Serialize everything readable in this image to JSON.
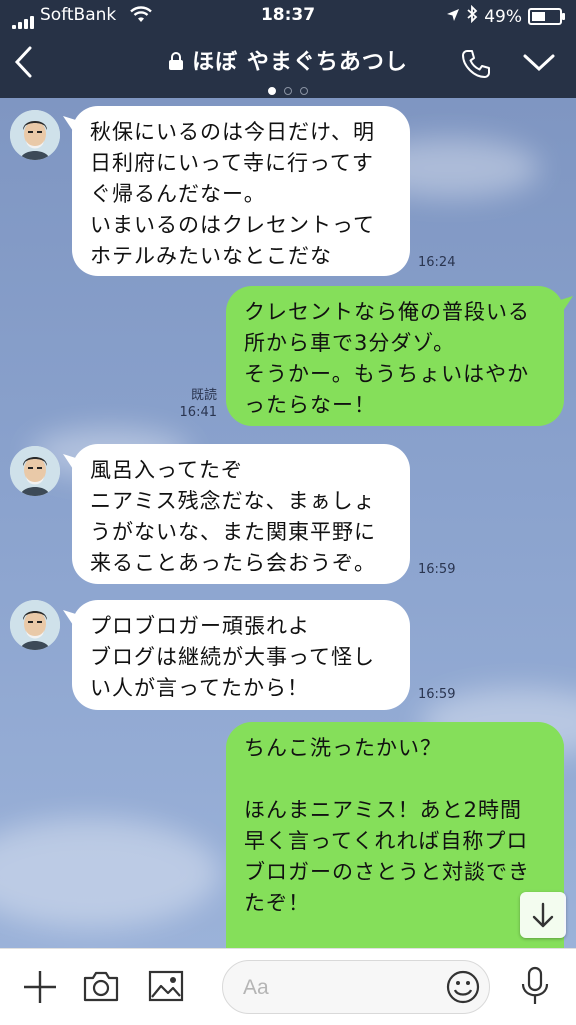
{
  "status": {
    "carrier": "SoftBank",
    "time": "18:37",
    "battery": "49%"
  },
  "header": {
    "title": "ほぼ やまぐちあつし",
    "page_dots": 3,
    "active_dot": 0
  },
  "messages": [
    {
      "side": "in",
      "text": "秋保にいるのは今日だけ、明\n日利府にいって寺に行ってす\nぐ帰るんだなー。\nいまいるのはクレセントって\nホテルみたいなとこだな",
      "time": "16:24"
    },
    {
      "side": "out",
      "text": "クレセントなら俺の普段いる\n所から車で3分ダゾ。\nそうかー。もうちょいはやか\nったらなー！",
      "read": "既読",
      "time": "16:41"
    },
    {
      "side": "in",
      "text": "風呂入ってたぞ\nニアミス残念だな、まぁしょ\nうがないな、また関東平野に\n来ることあったら会おうぞ。",
      "time": "16:59"
    },
    {
      "side": "in",
      "text": "プロブロガー頑張れよ\nブログは継続が大事って怪し\nい人が言ってたから！",
      "time": "16:59"
    },
    {
      "side": "out",
      "text": "ちんこ洗ったかい？\n\nほんまニアミス！あと2時間\n早く言ってくれれば自称プロ\nブロガーのさとうと対談でき\nたぞ！\n\nありがとうぞ！関東平野行く"
    }
  ],
  "input": {
    "placeholder": "Aa"
  },
  "colors": {
    "header_bg": "#273246",
    "outgoing_bubble": "#85df5a",
    "incoming_bubble": "#ffffff",
    "chat_bg": "#8aa2cd"
  }
}
